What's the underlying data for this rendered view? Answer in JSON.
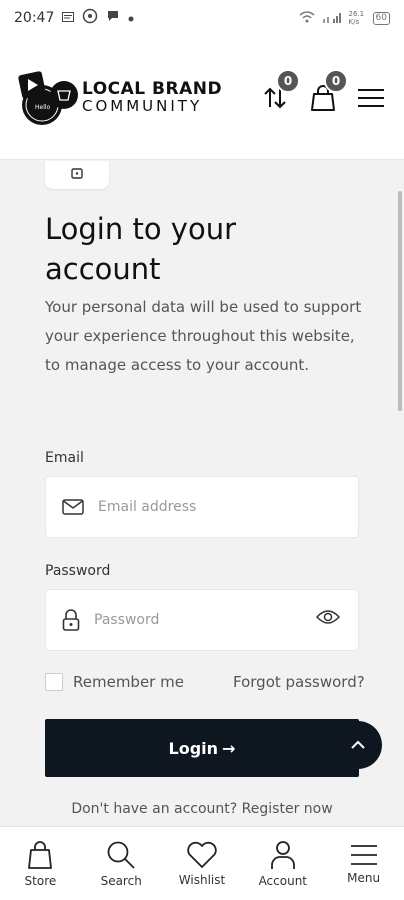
{
  "status_bar": {
    "time": "20:47",
    "speed": "26.1 K/s",
    "battery": "60"
  },
  "header": {
    "logo_line1": "LOCAL BRAND",
    "logo_line2": "COMMUNITY",
    "compare_count": "0",
    "cart_count": "0"
  },
  "login": {
    "title": "Login to your account",
    "description": "Your personal data will be used to support your experience throughout this website, to manage access to your account.",
    "email_label": "Email",
    "email_placeholder": "Email address",
    "password_label": "Password",
    "password_placeholder": "Password",
    "remember_label": "Remember me",
    "forgot_label": "Forgot password?",
    "login_button": "Login",
    "login_arrow": "→",
    "register_text": "Don't have an account? Register now"
  },
  "bottom_nav": {
    "items": [
      {
        "label": "Store",
        "icon": "bag-icon"
      },
      {
        "label": "Search",
        "icon": "search-icon"
      },
      {
        "label": "Wishlist",
        "icon": "heart-icon"
      },
      {
        "label": "Account",
        "icon": "user-icon"
      },
      {
        "label": "Menu",
        "icon": "menu-icon"
      }
    ]
  },
  "colors": {
    "primary_dark": "#0e1620",
    "badge": "#555555",
    "background": "#f2f2f2"
  }
}
